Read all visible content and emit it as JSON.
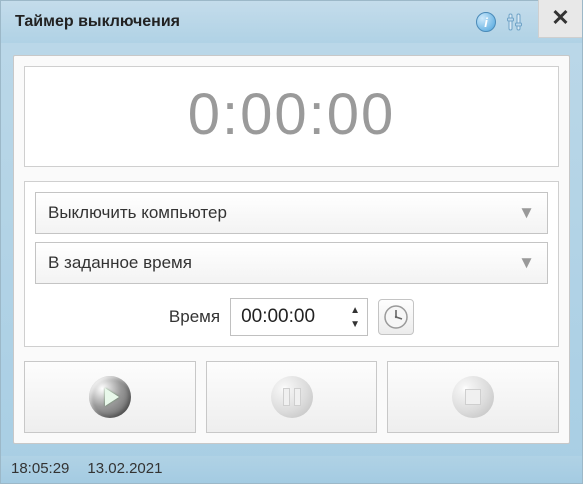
{
  "window": {
    "title": "Таймер выключения"
  },
  "timer": {
    "display": "0:00:00"
  },
  "action_select": {
    "value": "Выключить компьютер"
  },
  "mode_select": {
    "value": "В заданное время"
  },
  "time_field": {
    "label": "Время",
    "value": "00:00:00"
  },
  "status": {
    "time": "18:05:29",
    "date": "13.02.2021"
  }
}
